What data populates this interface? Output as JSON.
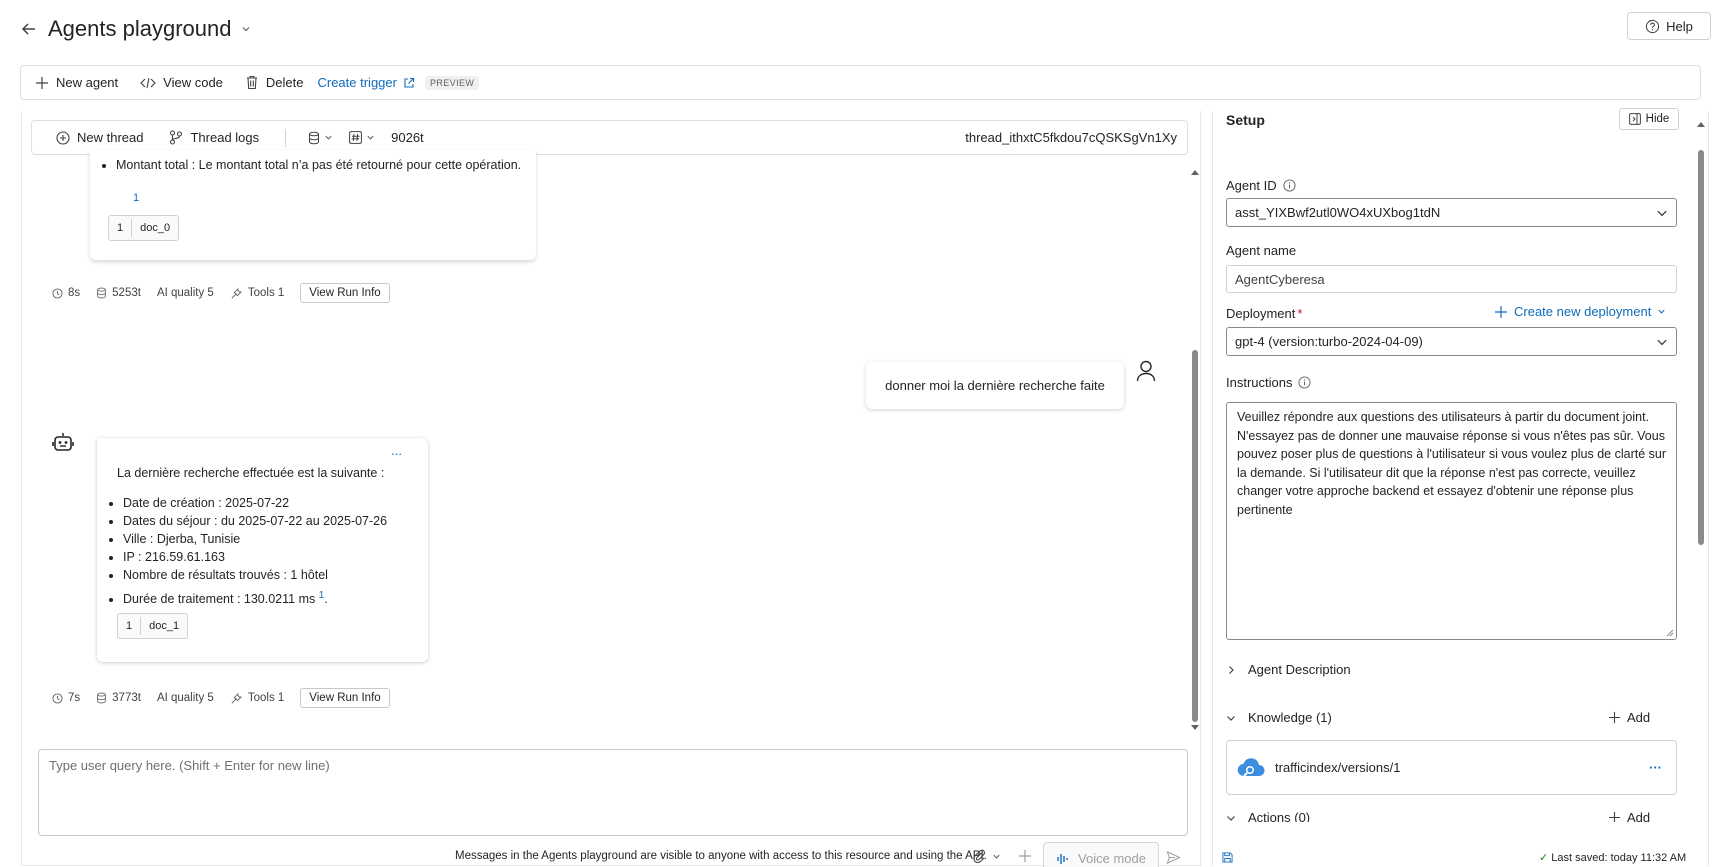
{
  "header": {
    "title": "Agents playground",
    "help_label": "Help"
  },
  "toolbar": {
    "new_agent": "New agent",
    "view_code": "View code",
    "delete": "Delete",
    "create_trigger": "Create trigger",
    "preview_badge": "PREVIEW"
  },
  "thread_bar": {
    "new_thread": "New thread",
    "thread_logs": "Thread logs",
    "token_count": "9026t",
    "thread_id": "thread_ithxtC5fkdou7cQSKSgVn1Xy"
  },
  "messages": {
    "first": {
      "bullet": "Montant total : Le montant total n’a pas été retourné pour cette opération.",
      "footnote": "1",
      "doc_num": "1",
      "doc_name": "doc_0",
      "stats": {
        "time": "8s",
        "tokens": "5253t",
        "quality": "AI quality 5",
        "tools": "Tools 1",
        "run_info": "View Run Info"
      }
    },
    "user": {
      "text": "donner moi la dernière recherche faite"
    },
    "second": {
      "more": "...",
      "intro": "La dernière recherche effectuée est la suivante :",
      "bullets": [
        "Date de création : 2025-07-22",
        "Dates du séjour : du 2025-07-22 au 2025-07-26",
        "Ville : Djerba, Tunisie",
        "IP : 216.59.61.163",
        "Nombre de résultats trouvés : 1 hôtel",
        "Durée de traitement : 130.0211 ms"
      ],
      "ref": "1",
      "doc_num": "1",
      "doc_name": "doc_1",
      "stats": {
        "time": "7s",
        "tokens": "3773t",
        "quality": "AI quality 5",
        "tools": "Tools 1",
        "run_info": "View Run Info"
      }
    }
  },
  "composer": {
    "placeholder": "Type user query here. (Shift + Enter for new line)",
    "notice": "Messages in the Agents playground are visible to anyone with access to this resource and using the API.",
    "voice_mode": "Voice mode"
  },
  "setup": {
    "title": "Setup",
    "hide": "Hide",
    "agent_id_label": "Agent ID",
    "agent_id_value": "asst_YIXBwf2utl0WO4xUXbog1tdN",
    "agent_name_label": "Agent name",
    "agent_name_value": "AgentCyberesa",
    "deployment_label": "Deployment",
    "deployment_required": "*",
    "create_deployment": "Create new deployment",
    "deployment_value": "gpt-4 (version:turbo-2024-04-09)",
    "instructions_label": "Instructions",
    "instructions_value": "Veuillez répondre aux questions des utilisateurs à partir du document joint. N'essayez pas de donner une mauvaise réponse si vous n'êtes pas sûr. Vous pouvez poser plus de questions à l'utilisateur si vous voulez plus de clarté sur la demande. Si l'utilisateur dit que la réponse n'est pas correcte, veuillez changer votre approche backend et essayez d'obtenir une réponse plus pertinente",
    "agent_description": "Agent Description",
    "knowledge": "Knowledge (1)",
    "add": "Add",
    "knowledge_item": "trafficindex/versions/1",
    "knowledge_more": "···",
    "actions": "Actions (0)",
    "last_saved": "Last saved: today 11:32 AM",
    "saved_check": "✓"
  },
  "colors": {
    "accent": "#0f6cbd",
    "success": "#107c10",
    "required": "#c50f1f"
  }
}
